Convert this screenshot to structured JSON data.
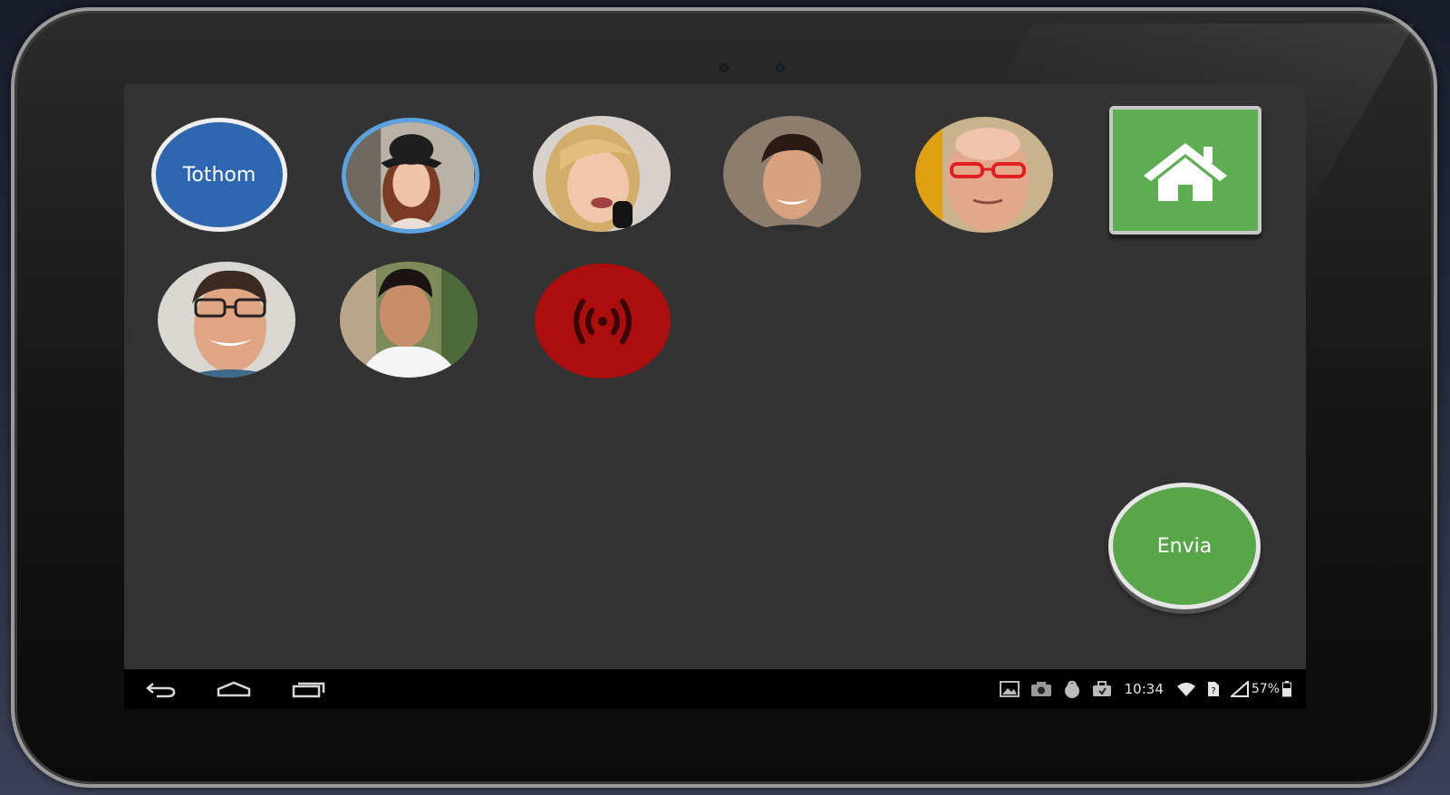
{
  "contacts": {
    "everyone_label": "Tothom",
    "people": [
      {
        "id": "contact-1",
        "selected": true
      },
      {
        "id": "contact-2",
        "selected": false
      },
      {
        "id": "contact-3",
        "selected": false
      },
      {
        "id": "contact-4",
        "selected": false
      },
      {
        "id": "contact-5",
        "selected": false
      },
      {
        "id": "contact-6",
        "selected": false
      }
    ]
  },
  "actions": {
    "home_icon": "home-icon",
    "broadcast_icon": "broadcast-icon",
    "send_label": "Envia"
  },
  "statusbar": {
    "time": "10:34",
    "battery": "57%",
    "icons": [
      "gallery-icon",
      "camera-icon",
      "lock-icon",
      "briefcase-icon",
      "wifi-icon",
      "sim-icon",
      "signal-icon",
      "battery-icon"
    ]
  },
  "navbar": {
    "icons": [
      "back-icon",
      "home-nav-icon",
      "recent-apps-icon"
    ]
  },
  "colors": {
    "screen_bg": "#333333",
    "everyone_blue": "#2f66b0",
    "selected_ring": "#5ba3e0",
    "home_green": "#5fad52",
    "send_green": "#59a64a",
    "broadcast_red": "#ac0e0e"
  }
}
